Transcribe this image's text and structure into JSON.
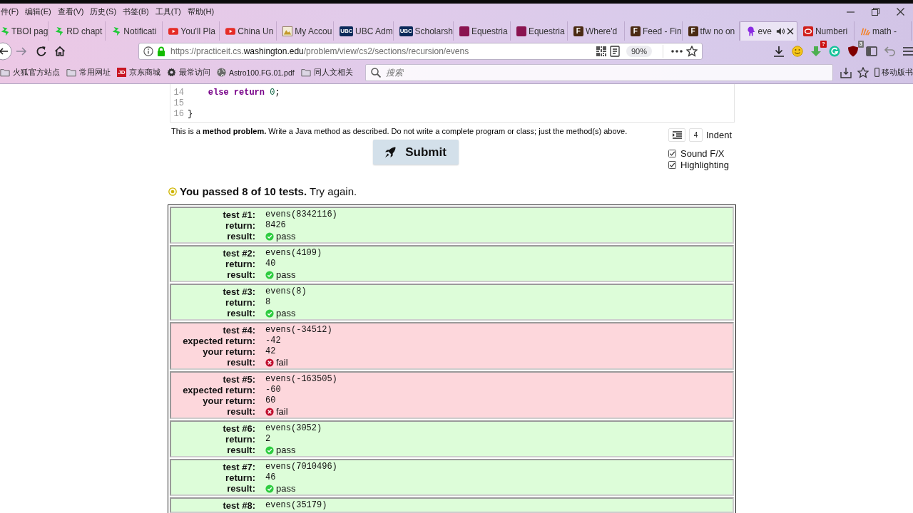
{
  "menu": [
    "件(F)",
    "编辑(E)",
    "查看(V)",
    "历史(S)",
    "书签(B)",
    "工具(T)",
    "帮助(H)"
  ],
  "tabs": [
    {
      "label": "TBOI pag",
      "selected": false,
      "sound": false,
      "kind": "bolt"
    },
    {
      "label": "RD chapt",
      "selected": false,
      "sound": false,
      "kind": "bolt"
    },
    {
      "label": "Notificati",
      "selected": false,
      "sound": false,
      "kind": "bolt"
    },
    {
      "label": "You'll Pla",
      "selected": false,
      "sound": false,
      "kind": "play"
    },
    {
      "label": "China Un",
      "selected": false,
      "sound": false,
      "kind": "play"
    },
    {
      "label": "My Accou",
      "selected": false,
      "sound": false,
      "kind": "picture"
    },
    {
      "label": "UBC Adm",
      "selected": false,
      "sound": false,
      "kind": "tile",
      "color": "#0c2a5a",
      "icon_text": "UBC"
    },
    {
      "label": "Scholarsh",
      "selected": false,
      "sound": false,
      "kind": "tile",
      "color": "#0c2a5a",
      "icon_text": "UBC"
    },
    {
      "label": "Equestria",
      "selected": false,
      "sound": false,
      "kind": "tile",
      "color": "#8a1450"
    },
    {
      "label": "Equestria",
      "selected": false,
      "sound": false,
      "kind": "tile",
      "color": "#8a1450"
    },
    {
      "label": "Where'd",
      "selected": false,
      "sound": false,
      "kind": "tile",
      "color": "#4a2a12",
      "icon_text": "F"
    },
    {
      "label": "Feed - Fin",
      "selected": false,
      "sound": false,
      "kind": "tile",
      "color": "#4a2a12",
      "icon_text": "F"
    },
    {
      "label": "tfw no on",
      "selected": false,
      "sound": false,
      "kind": "tile",
      "color": "#4a2a12",
      "icon_text": "F"
    },
    {
      "label": "eve",
      "selected": true,
      "sound": true,
      "kind": "silhouette"
    },
    {
      "label": "Numberi",
      "selected": false,
      "sound": false,
      "kind": "ring"
    },
    {
      "label": "math -",
      "selected": false,
      "sound": false,
      "kind": "lines"
    }
  ],
  "address_bar": {
    "url": [
      {
        "text": "https://practiceit.cs.",
        "kind": "dim"
      },
      {
        "text": "washington.edu",
        "kind": "host"
      },
      {
        "text": "/problem/view/cs2/sections/recursion/evens",
        "kind": "dim"
      }
    ],
    "zoom": "90%"
  },
  "toolbar": {
    "badges": [
      "?",
      "3"
    ]
  },
  "bookmarks": [
    {
      "label": "火狐官方站点",
      "kind": "folder"
    },
    {
      "label": "常用网址",
      "kind": "folder"
    },
    {
      "label": "京东商城",
      "kind": "tile",
      "icon_text": "JD"
    },
    {
      "label": "最常访问",
      "kind": "gear"
    },
    {
      "label": "Astro100.FG.01.pdf",
      "kind": "globe"
    },
    {
      "label": "同人文相关",
      "kind": "folder"
    }
  ],
  "bookmark_search": {
    "placeholder": "搜索"
  },
  "mobile_bookmarks": "移动版书",
  "editor": {
    "lines": [
      {
        "number": "14",
        "tokens": [
          {
            "kind": "keyword",
            "text": "    else return "
          },
          {
            "kind": "number",
            "text": "0"
          },
          {
            "kind": "plain",
            "text": ";"
          }
        ]
      },
      {
        "number": "15"
      },
      {
        "number": "16",
        "tokens": [
          {
            "kind": "plain",
            "text": "}"
          }
        ]
      }
    ]
  },
  "description": "This is a **method problem.** Write a Java method as described. Do not write a complete program or class; just the method(s) above.",
  "indent": {
    "value": "4",
    "label": "Indent"
  },
  "options": [
    {
      "label": "Sound F/X",
      "checked": true
    },
    {
      "label": "Highlighting",
      "checked": true
    }
  ],
  "submit": "Submit",
  "summary": {
    "text": "**You passed 8 of 10 tests.** Try again.",
    "kind": "partial"
  },
  "tests": [
    {
      "kind": "pass",
      "fields": [
        {
          "label": "test #1:",
          "value": "evens(8342116)",
          "kind": "code"
        },
        {
          "label": "return:",
          "value": "8426",
          "kind": "code"
        },
        {
          "label": "result:",
          "value": "pass",
          "kind": "result"
        }
      ]
    },
    {
      "kind": "pass",
      "fields": [
        {
          "label": "test #2:",
          "value": "evens(4109)",
          "kind": "code"
        },
        {
          "label": "return:",
          "value": "40",
          "kind": "code"
        },
        {
          "label": "result:",
          "value": "pass",
          "kind": "result"
        }
      ]
    },
    {
      "kind": "pass",
      "fields": [
        {
          "label": "test #3:",
          "value": "evens(8)",
          "kind": "code"
        },
        {
          "label": "return:",
          "value": "8",
          "kind": "code"
        },
        {
          "label": "result:",
          "value": "pass",
          "kind": "result"
        }
      ]
    },
    {
      "kind": "fail",
      "fields": [
        {
          "label": "test #4:",
          "value": "evens(-34512)",
          "kind": "code"
        },
        {
          "label": "expected return:",
          "value": "-42",
          "kind": "code"
        },
        {
          "label": "your return:",
          "value": "42",
          "kind": "code"
        },
        {
          "label": "result:",
          "value": "fail",
          "kind": "result"
        }
      ]
    },
    {
      "kind": "fail",
      "fields": [
        {
          "label": "test #5:",
          "value": "evens(-163505)",
          "kind": "code"
        },
        {
          "label": "expected return:",
          "value": "-60",
          "kind": "code"
        },
        {
          "label": "your return:",
          "value": "60",
          "kind": "code"
        },
        {
          "label": "result:",
          "value": "fail",
          "kind": "result"
        }
      ]
    },
    {
      "kind": "pass",
      "fields": [
        {
          "label": "test #6:",
          "value": "evens(3052)",
          "kind": "code"
        },
        {
          "label": "return:",
          "value": "2",
          "kind": "code"
        },
        {
          "label": "result:",
          "value": "pass",
          "kind": "result"
        }
      ]
    },
    {
      "kind": "pass",
      "fields": [
        {
          "label": "test #7:",
          "value": "evens(7010496)",
          "kind": "code"
        },
        {
          "label": "return:",
          "value": "46",
          "kind": "code"
        },
        {
          "label": "result:",
          "value": "pass",
          "kind": "result"
        }
      ]
    },
    {
      "kind": "pass",
      "fields": [
        {
          "label": "test #8:",
          "value": "evens(35179)",
          "kind": "code"
        }
      ]
    }
  ]
}
